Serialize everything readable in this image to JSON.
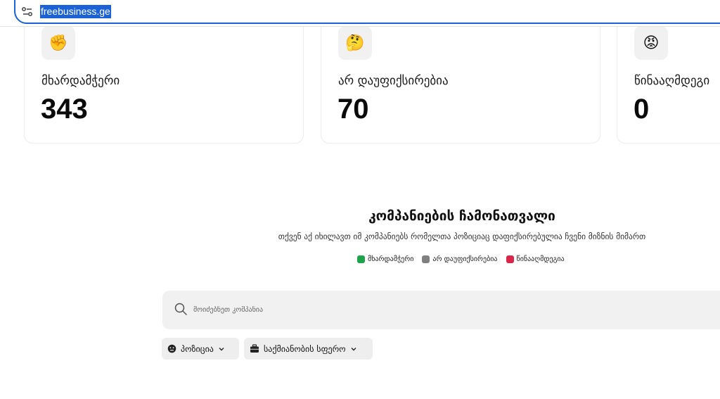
{
  "browser": {
    "url": "freebusiness.ge"
  },
  "stats": [
    {
      "emoji": "✊",
      "label": "მხარდამჭერი",
      "value": "343"
    },
    {
      "emoji": "🤔",
      "label": "არ დაუფიქსირებია",
      "value": "70"
    },
    {
      "emoji": "😡",
      "label": "წინააღმდეგი",
      "value": "0"
    }
  ],
  "section": {
    "title": "კომპანიების ჩამონათვალი",
    "subtitle": "თქვენ აქ იხილავთ იმ კომპანიებს რომელთა პოზიციაც დაფიქსირებულია ჩვენი მიზნის მიმართ"
  },
  "legend": [
    {
      "label": "მხარდამჭერი",
      "color": "#1fa34a"
    },
    {
      "label": "არ დაუფიქსირებია",
      "color": "#808080"
    },
    {
      "label": "წინააღმდეგია",
      "color": "#d9264a"
    }
  ],
  "search": {
    "placeholder": "მოიძებნეთ კომპანია"
  },
  "filters": {
    "position_label": "პოზიცია",
    "sector_label": "საქმიანობის სფერო"
  }
}
